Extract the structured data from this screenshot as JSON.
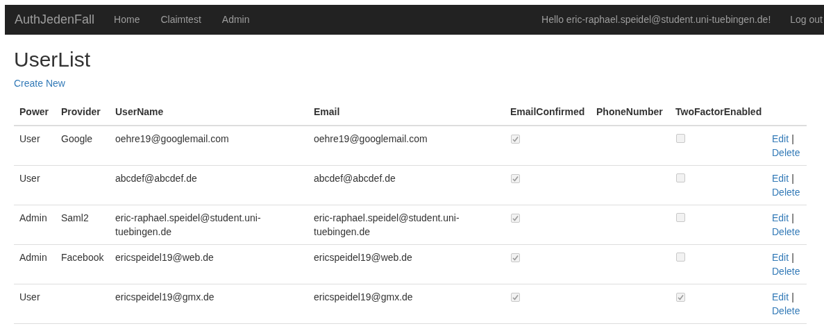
{
  "navbar": {
    "brand": "AuthJedenFall",
    "links": [
      "Home",
      "Claimtest",
      "Admin"
    ],
    "greeting": "Hello eric-raphael.speidel@student.uni-tuebingen.de!",
    "logout": "Log out"
  },
  "heading": "UserList",
  "create_link": "Create New",
  "table": {
    "columns": [
      "Power",
      "Provider",
      "UserName",
      "Email",
      "EmailConfirmed",
      "PhoneNumber",
      "TwoFactorEnabled"
    ],
    "rows": [
      {
        "power": "User",
        "provider": "Google",
        "username": "oehre19@googlemail.com",
        "email": "oehre19@googlemail.com",
        "email_confirmed": true,
        "two_factor_enabled": false,
        "edit": "Edit",
        "separator": "|",
        "delete": "Delete"
      },
      {
        "power": "User",
        "username": "abcdef@abcdef.de",
        "email": "abcdef@abcdef.de",
        "email_confirmed": true,
        "two_factor_enabled": false,
        "edit": "Edit",
        "separator": "|",
        "delete": "Delete"
      },
      {
        "power": "Admin",
        "provider": "Saml2",
        "username": "eric-raphael.speidel@student.uni-tuebingen.de",
        "email": "eric-raphael.speidel@student.uni-tuebingen.de",
        "email_confirmed": true,
        "two_factor_enabled": false,
        "edit": "Edit",
        "separator": "|",
        "delete": "Delete"
      },
      {
        "power": "Admin",
        "provider": "Facebook",
        "username": "ericspeidel19@web.de",
        "email": "ericspeidel19@web.de",
        "email_confirmed": true,
        "two_factor_enabled": false,
        "edit": "Edit",
        "separator": "|",
        "delete": "Delete"
      },
      {
        "power": "User",
        "username": "ericspeidel19@gmx.de",
        "email": "ericspeidel19@gmx.de",
        "email_confirmed": true,
        "two_factor_enabled": true,
        "edit": "Edit",
        "separator": "|",
        "delete": "Delete"
      }
    ]
  }
}
